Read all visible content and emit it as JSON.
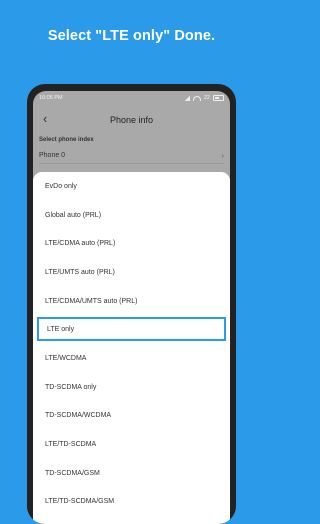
{
  "headline": "Select \"LTE only\" Done.",
  "status_bar": {
    "time": "10:05 PM",
    "battery": "22"
  },
  "app_bar": {
    "title": "Phone info"
  },
  "phone_index": {
    "label": "Select phone index",
    "value": "Phone 0"
  },
  "network_options": [
    "EvDo only",
    "Global auto (PRL)",
    "LTE/CDMA auto (PRL)",
    "LTE/UMTS auto (PRL)",
    "LTE/CDMA/UMTS auto (PRL)",
    "LTE only",
    "LTE/WCDMA",
    "TD-SCDMA only",
    "TD-SCDMA/WCDMA",
    "LTE/TD-SCDMA",
    "TD-SCDMA/GSM",
    "LTE/TD-SCDMA/GSM"
  ],
  "selected_option": "LTE only",
  "colors": {
    "accent": "#2b9ae8",
    "overlay": "#a9a9a9",
    "sheet": "#ffffff"
  }
}
